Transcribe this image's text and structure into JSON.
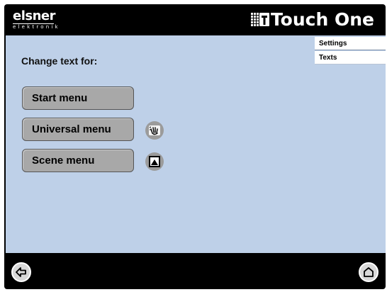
{
  "header": {
    "logo_main": "elsner",
    "logo_sub": "elektronik",
    "brand_title": "Touch One",
    "brand_icon": "grid-t-icon"
  },
  "sidebar": {
    "items": [
      {
        "label": "Settings"
      },
      {
        "label": "Texts"
      }
    ]
  },
  "main": {
    "title": "Change text for:",
    "buttons": [
      {
        "label": "Start menu",
        "icon": null
      },
      {
        "label": "Universal menu",
        "icon": "hand-wave-icon"
      },
      {
        "label": "Scene menu",
        "icon": "scene-icon"
      }
    ]
  },
  "footer": {
    "back_icon": "arrow-left-icon",
    "home_icon": "home-icon"
  },
  "colors": {
    "background": "#000000",
    "content": "#bed0e8",
    "button": "#a8a8a8"
  }
}
